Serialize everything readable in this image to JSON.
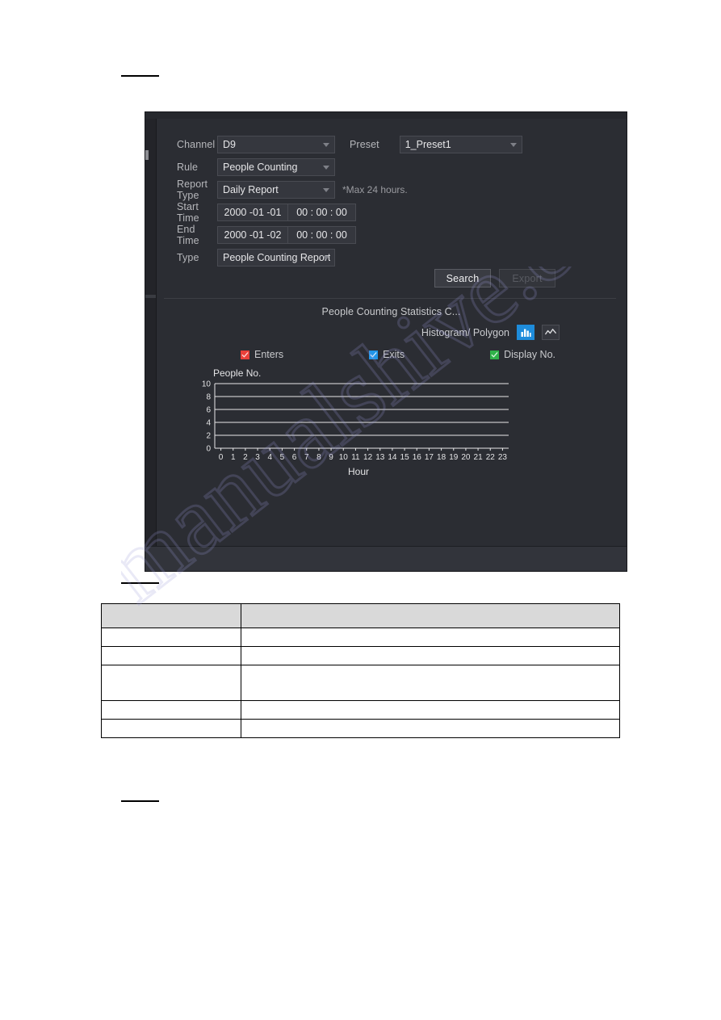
{
  "document": {
    "captions": [
      "",
      "",
      ""
    ],
    "watermark_text": "manualshive.com"
  },
  "dialog": {
    "form": {
      "channel": {
        "label": "Channel",
        "value": "D9",
        "options": [
          "D9"
        ]
      },
      "preset": {
        "label": "Preset",
        "value": "1_Preset1",
        "options": [
          "1_Preset1"
        ]
      },
      "rule": {
        "label": "Rule",
        "value": "People Counting",
        "options": [
          "People Counting"
        ]
      },
      "report_type": {
        "label": "Report Type",
        "value": "Daily Report",
        "options": [
          "Daily Report"
        ],
        "hint": "*Max 24 hours."
      },
      "start_time": {
        "label": "Start Time",
        "date": "2000 -01 -01",
        "time": "00 : 00 : 00"
      },
      "end_time": {
        "label": "End Time",
        "date": "2000 -01 -02",
        "time": "00 : 00 : 00"
      },
      "type": {
        "label": "Type",
        "value": "People Counting Report",
        "options": [
          "People Counting Report"
        ]
      }
    },
    "actions": {
      "search_label": "Search",
      "export_label": "Export",
      "export_disabled": true
    },
    "chart_header": {
      "title": "People Counting Statistics C...",
      "mode_label": "Histogram/ Polygon",
      "histogram_icon": "bar-chart-icon",
      "polygon_icon": "line-chart-icon",
      "active_mode": "histogram"
    },
    "legend": [
      {
        "label": "Enters",
        "color": "#e8403a",
        "checked": true
      },
      {
        "label": "Exits",
        "color": "#2196e8",
        "checked": true
      },
      {
        "label": "Display No.",
        "color": "#2fb24a",
        "checked": true
      }
    ],
    "colors": {
      "panel_bg": "#2b2d33",
      "field_bg": "#35373e",
      "accent_blue": "#1e8cdb",
      "grid_line": "#e8e8ea"
    }
  },
  "chart_data": {
    "type": "bar",
    "title": "People Counting Statistics C...",
    "xlabel": "Hour",
    "ylabel": "People No.",
    "categories": [
      "0",
      "1",
      "2",
      "3",
      "4",
      "5",
      "6",
      "7",
      "8",
      "9",
      "10",
      "11",
      "12",
      "13",
      "14",
      "15",
      "16",
      "17",
      "18",
      "19",
      "20",
      "21",
      "22",
      "23"
    ],
    "yticks": [
      0,
      2,
      4,
      6,
      8,
      10
    ],
    "ylim": [
      0,
      10
    ],
    "grid": true,
    "legend_position": "above-plot",
    "series": [
      {
        "name": "Enters",
        "color": "#e8403a",
        "values": [
          0,
          0,
          0,
          0,
          0,
          0,
          0,
          0,
          0,
          0,
          0,
          0,
          0,
          0,
          0,
          0,
          0,
          0,
          0,
          0,
          0,
          0,
          0,
          0
        ]
      },
      {
        "name": "Exits",
        "color": "#2196e8",
        "values": [
          0,
          0,
          0,
          0,
          0,
          0,
          0,
          0,
          0,
          0,
          0,
          0,
          0,
          0,
          0,
          0,
          0,
          0,
          0,
          0,
          0,
          0,
          0,
          0
        ]
      },
      {
        "name": "Display No.",
        "color": "#2fb24a",
        "values": [
          0,
          0,
          0,
          0,
          0,
          0,
          0,
          0,
          0,
          0,
          0,
          0,
          0,
          0,
          0,
          0,
          0,
          0,
          0,
          0,
          0,
          0,
          0,
          0
        ]
      }
    ]
  },
  "doc_table": {
    "header": [
      "",
      ""
    ],
    "rows": [
      [
        "",
        ""
      ],
      [
        "",
        ""
      ],
      [
        "",
        ""
      ],
      [
        "",
        ""
      ],
      [
        "",
        ""
      ]
    ]
  }
}
